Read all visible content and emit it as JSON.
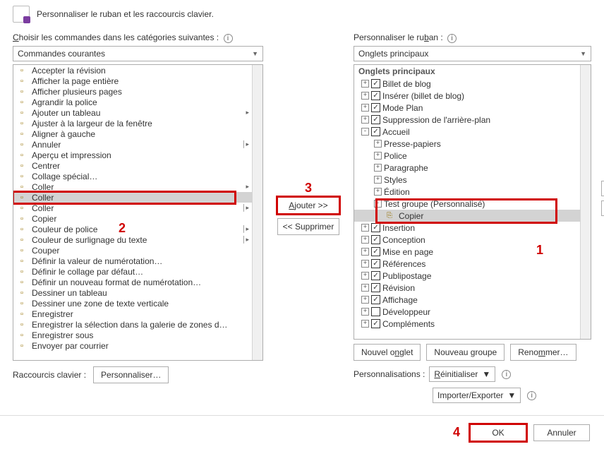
{
  "header": {
    "title": "Personnaliser le ruban et les raccourcis clavier."
  },
  "left": {
    "label": "Choisir les commandes dans les catégories suivantes :",
    "combo": "Commandes courantes",
    "commands": [
      {
        "name": "Accepter la révision"
      },
      {
        "name": "Afficher la page entière"
      },
      {
        "name": "Afficher plusieurs pages"
      },
      {
        "name": "Agrandir la police"
      },
      {
        "name": "Ajouter un tableau",
        "submenu": true
      },
      {
        "name": "Ajuster à la largeur de la fenêtre"
      },
      {
        "name": "Aligner à gauche"
      },
      {
        "name": "Annuler",
        "submenu": true,
        "split": true
      },
      {
        "name": "Aperçu et impression"
      },
      {
        "name": "Centrer"
      },
      {
        "name": "Collage spécial…"
      },
      {
        "name": "Coller",
        "submenu": true
      },
      {
        "name": "Coller",
        "highlight": true
      },
      {
        "name": "Coller",
        "submenu": true,
        "split": true
      },
      {
        "name": "Copier"
      },
      {
        "name": "Couleur de police",
        "submenu": true,
        "split": true
      },
      {
        "name": "Couleur de surlignage du texte",
        "submenu": true,
        "split": true
      },
      {
        "name": "Couper"
      },
      {
        "name": "Définir la valeur de numérotation…"
      },
      {
        "name": "Définir le collage par défaut…"
      },
      {
        "name": "Définir un nouveau format de numérotation…"
      },
      {
        "name": "Dessiner un tableau"
      },
      {
        "name": "Dessiner une zone de texte verticale"
      },
      {
        "name": "Enregistrer"
      },
      {
        "name": "Enregistrer la sélection dans la galerie de zones d…"
      },
      {
        "name": "Enregistrer sous"
      },
      {
        "name": "Envoyer par courrier"
      }
    ],
    "kb_label": "Raccourcis clavier :",
    "kb_button": "Personnaliser…"
  },
  "mid": {
    "add": "Ajouter >>",
    "remove": "<< Supprimer"
  },
  "right": {
    "label": "Personnaliser le ruban :",
    "combo": "Onglets principaux",
    "tree_header": "Onglets principaux",
    "tree": [
      {
        "lvl": 1,
        "pm": "+",
        "cb": true,
        "label": "Billet de blog"
      },
      {
        "lvl": 1,
        "pm": "+",
        "cb": true,
        "label": "Insérer (billet de blog)"
      },
      {
        "lvl": 1,
        "pm": "+",
        "cb": true,
        "label": "Mode Plan"
      },
      {
        "lvl": 1,
        "pm": "+",
        "cb": true,
        "label": "Suppression de l'arrière-plan"
      },
      {
        "lvl": 1,
        "pm": "-",
        "cb": true,
        "label": "Accueil"
      },
      {
        "lvl": 2,
        "pm": "+",
        "label": "Presse-papiers"
      },
      {
        "lvl": 2,
        "pm": "+",
        "label": "Police"
      },
      {
        "lvl": 2,
        "pm": "+",
        "label": "Paragraphe"
      },
      {
        "lvl": 2,
        "pm": "+",
        "label": "Styles"
      },
      {
        "lvl": 2,
        "pm": "+",
        "label": "Édition"
      },
      {
        "lvl": 2,
        "pm": "-",
        "label": "Test groupe (Personnalisé)",
        "boxed": true
      },
      {
        "lvl": 3,
        "icon": "copy",
        "label": "Copier",
        "selected": true,
        "boxed": true
      },
      {
        "lvl": 1,
        "pm": "+",
        "cb": true,
        "label": "Insertion"
      },
      {
        "lvl": 1,
        "pm": "+",
        "cb": true,
        "label": "Conception"
      },
      {
        "lvl": 1,
        "pm": "+",
        "cb": true,
        "label": "Mise en page"
      },
      {
        "lvl": 1,
        "pm": "+",
        "cb": true,
        "label": "Références"
      },
      {
        "lvl": 1,
        "pm": "+",
        "cb": true,
        "label": "Publipostage"
      },
      {
        "lvl": 1,
        "pm": "+",
        "cb": true,
        "label": "Révision"
      },
      {
        "lvl": 1,
        "pm": "+",
        "cb": true,
        "label": "Affichage"
      },
      {
        "lvl": 1,
        "pm": "+",
        "cb": false,
        "label": "Développeur"
      },
      {
        "lvl": 1,
        "pm": "+",
        "cb": true,
        "label": "Compléments"
      }
    ],
    "btn_new_tab": "Nouvel onglet",
    "btn_new_group": "Nouveau groupe",
    "btn_rename": "Renommer…",
    "cust_label": "Personnalisations :",
    "reset": "Réinitialiser",
    "import_export": "Importer/Exporter"
  },
  "bottom": {
    "ok": "OK",
    "cancel": "Annuler"
  },
  "annotations": {
    "n1": "1",
    "n2": "2",
    "n3": "3",
    "n4": "4"
  }
}
